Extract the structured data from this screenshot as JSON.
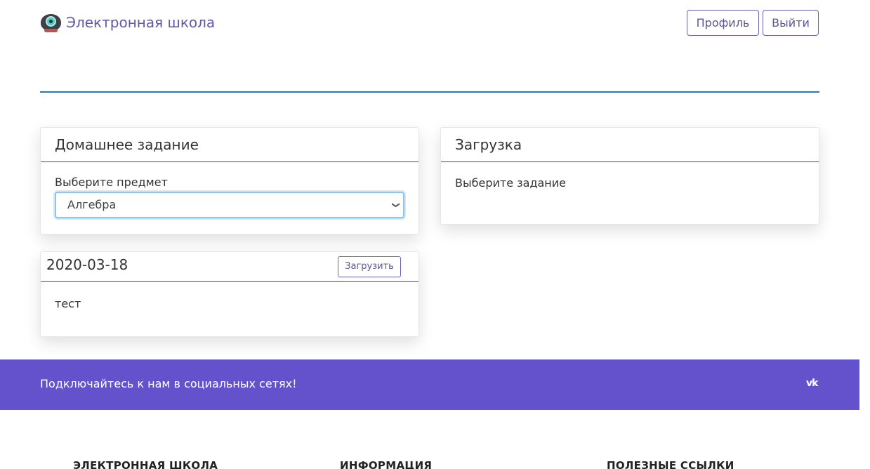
{
  "header": {
    "brand": "Электронная школа",
    "profile_label": "Профиль",
    "logout_label": "Выйти"
  },
  "homework_card": {
    "title": "Домашнее задание",
    "select_label": "Выберите предмет",
    "selected_subject": "Алгебра"
  },
  "upload_card": {
    "title": "Загрузка",
    "message": "Выберите задание"
  },
  "task_card": {
    "date": "2020-03-18",
    "upload_label": "Загрузить",
    "text": "тест"
  },
  "social": {
    "text": "Подключайтесь к нам в социальных сетях!",
    "vk_label": "vk"
  },
  "footer": {
    "headings": [
      "ЭЛЕКТРОННАЯ ШКОЛА",
      "ИНФОРМАЦИЯ",
      "ПОЛЕЗНЫЕ ССЫЛКИ"
    ]
  },
  "colors": {
    "accent": "#6452cc",
    "divider": "#2a7ab8",
    "brand_text": "#6258a8"
  }
}
